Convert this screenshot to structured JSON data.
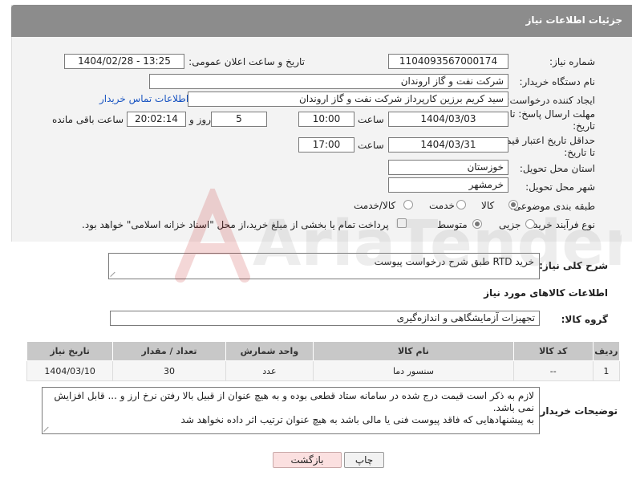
{
  "header": {
    "title": "جزئیات اطلاعات نیاز"
  },
  "form": {
    "need_number_label": "شماره نیاز:",
    "need_number": "1104093567000174",
    "announce_label": "تاریخ و ساعت اعلان عمومی:",
    "announce_value": "1404/02/28 - 13:25",
    "buyer_org_label": "نام دستگاه خریدار:",
    "buyer_org": "شرکت نفت و گاز اروندان",
    "requester_label": "ایجاد کننده درخواست:",
    "requester": "سید کریم برزین کارپرداز شرکت نفت و گاز اروندان",
    "buyer_contact_link": "اطلاعات تماس خریدار",
    "deadline_label_1": "مهلت ارسال پاسخ: تا",
    "deadline_label_2": "تاریخ:",
    "deadline_date": "1404/03/03",
    "time_label": "ساعت",
    "deadline_time": "10:00",
    "days_value": "5",
    "days_label": "روز و",
    "remaining_time": "20:02:14",
    "remaining_label": "ساعت باقی مانده",
    "price_validity_label_1": "حداقل تاریخ اعتبار قیمت:",
    "price_validity_label_2": "تا تاریخ:",
    "price_validity_date": "1404/03/31",
    "price_validity_time_label": "ساعت",
    "price_validity_time": "17:00",
    "province_label": "استان محل تحویل:",
    "province": "خوزستان",
    "city_label": "شهر محل تحویل:",
    "city": "خرمشهر",
    "category_label": "طبقه بندی موضوعی:",
    "category_options": [
      "کالا",
      "خدمت",
      "کالا/خدمت"
    ],
    "process_label": "نوع فرآیند خرید :",
    "process_options": [
      "جزیی",
      "متوسط"
    ],
    "payment_note": "پرداخت تمام یا بخشی از مبلغ خرید،از محل \"اسناد خزانه اسلامی\" خواهد بود."
  },
  "description": {
    "label": "شرح کلی نیاز:",
    "value": "خرید RTD طبق شرح درخواست پیوست"
  },
  "goods": {
    "section_title": "اطلاعات کالاهای مورد نیاز",
    "group_label": "گروه کالا:",
    "group_value": "تجهیزات آزمایشگاهی و اندازه‌گیری",
    "columns": [
      "ردیف",
      "کد کالا",
      "نام کالا",
      "واحد شمارش",
      "تعداد / مقدار",
      "تاریخ نیاز"
    ],
    "rows": [
      {
        "row": "1",
        "code": "--",
        "name": "سنسور دما",
        "unit": "عدد",
        "qty": "30",
        "date": "1404/03/10"
      }
    ]
  },
  "buyer_notes": {
    "label": "توضیحات خریدار:",
    "line1": "لازم به ذکر است قیمت درج شده در سامانه ستاد قطعی بوده و به هیچ عنوان از قبیل بالا رفتن نرخ ارز و ... قابل افزایش نمی باشد.",
    "line2": "به پیشنهادهایی که فاقد پیوست فنی یا مالی باشد به هیچ عنوان ترتیب اثر داده نخواهد شد"
  },
  "buttons": {
    "print": "چاپ",
    "back": "بازگشت"
  },
  "watermark": {
    "brand": "AriaTender.net"
  },
  "colors": {
    "header_bg": "#8c8c8c",
    "link": "#1a55c2",
    "back_button_bg": "#fbe0e0",
    "table_header_bg": "#c8c8c8"
  }
}
